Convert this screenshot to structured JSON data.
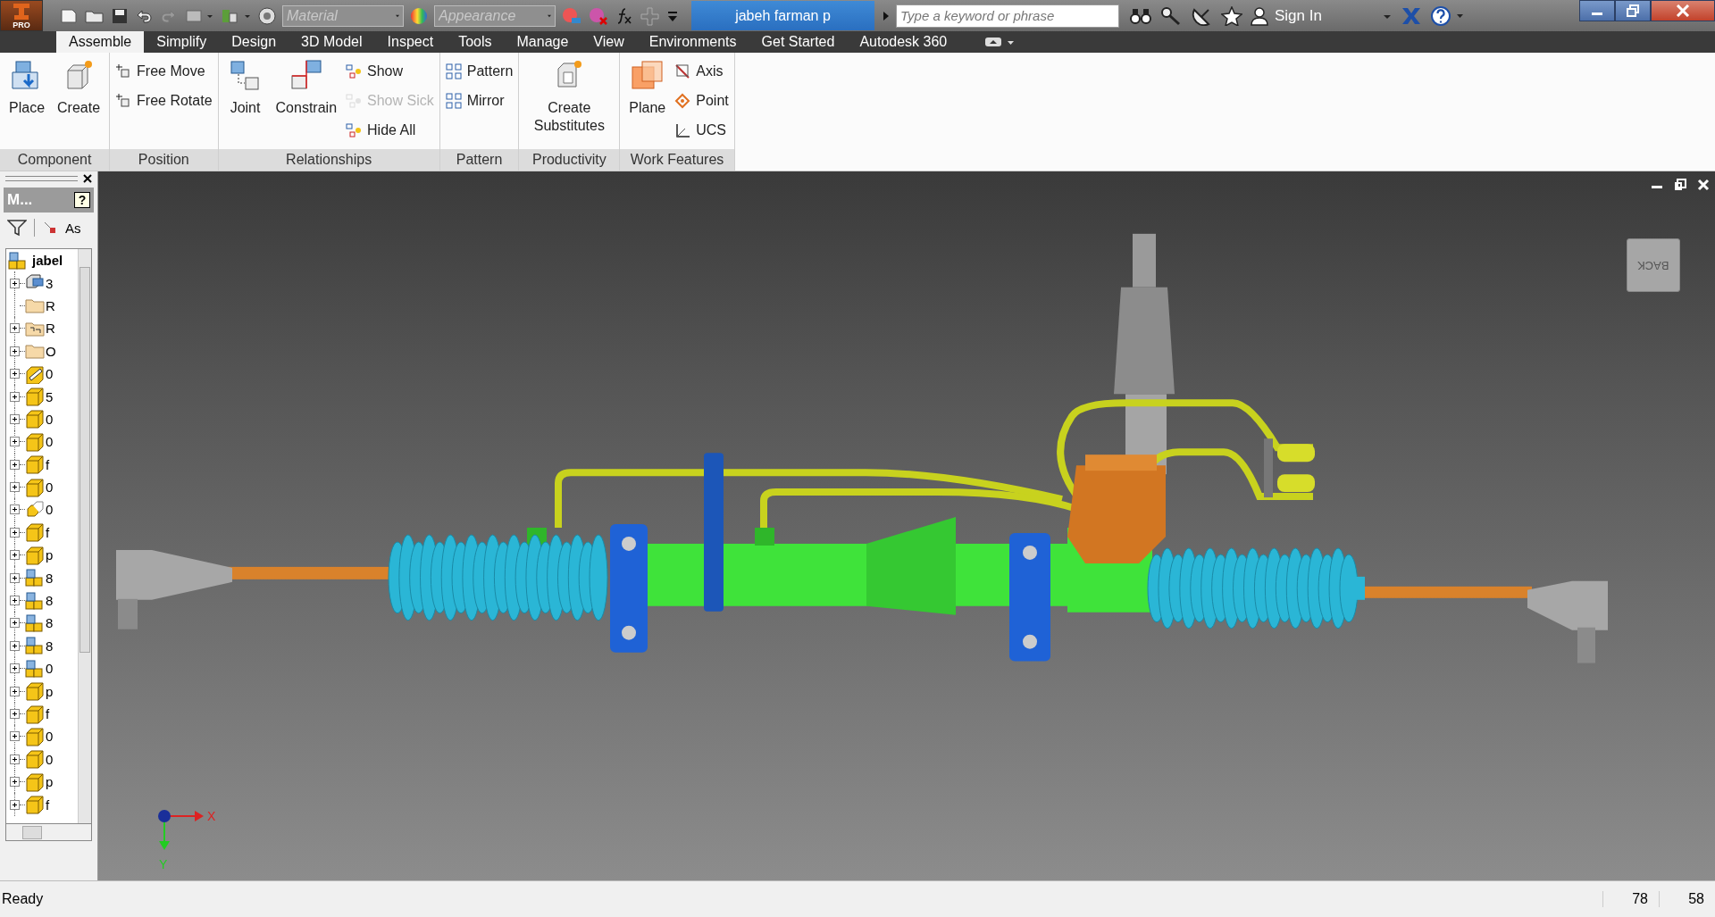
{
  "app_button": {
    "label": "PRO"
  },
  "quick_access": {
    "material": {
      "placeholder": "Material"
    },
    "appearance": {
      "placeholder": "Appearance"
    }
  },
  "document_title": "jabeh farman p",
  "search": {
    "placeholder": "Type a keyword or phrase"
  },
  "sign_in": "Sign In",
  "tabs": [
    {
      "label": "Assemble",
      "selected": true
    },
    {
      "label": "Simplify",
      "selected": false
    },
    {
      "label": "Design",
      "selected": false
    },
    {
      "label": "3D Model",
      "selected": false
    },
    {
      "label": "Inspect",
      "selected": false
    },
    {
      "label": "Tools",
      "selected": false
    },
    {
      "label": "Manage",
      "selected": false
    },
    {
      "label": "View",
      "selected": false
    },
    {
      "label": "Environments",
      "selected": false
    },
    {
      "label": "Get Started",
      "selected": false
    },
    {
      "label": "Autodesk 360",
      "selected": false
    }
  ],
  "ribbon": [
    {
      "title": "Component",
      "tools": [
        {
          "label": "Place",
          "kind": "large",
          "disabled": false
        },
        {
          "label": "Create",
          "kind": "large",
          "disabled": false
        }
      ]
    },
    {
      "title": "Position",
      "tools": [
        {
          "label": "Free Move",
          "kind": "small",
          "disabled": false
        },
        {
          "label": "Free Rotate",
          "kind": "small",
          "disabled": false
        }
      ]
    },
    {
      "title": "Relationships",
      "tools": [
        {
          "label": "Joint",
          "kind": "large",
          "disabled": false
        },
        {
          "label": "Constrain",
          "kind": "large",
          "disabled": false
        },
        {
          "label": "Show",
          "kind": "small",
          "disabled": false
        },
        {
          "label": "Show Sick",
          "kind": "small",
          "disabled": true
        },
        {
          "label": "Hide All",
          "kind": "small",
          "disabled": false
        }
      ]
    },
    {
      "title": "Pattern",
      "tools": [
        {
          "label": "Pattern",
          "kind": "small",
          "disabled": false
        },
        {
          "label": "Mirror",
          "kind": "small",
          "disabled": false
        }
      ]
    },
    {
      "title": "Productivity",
      "tools": [
        {
          "label": "Create Substitutes",
          "kind": "large",
          "disabled": false
        }
      ]
    },
    {
      "title": "Work Features",
      "tools": [
        {
          "label": "Plane",
          "kind": "large",
          "disabled": false
        },
        {
          "label": "Axis",
          "kind": "small",
          "disabled": false
        },
        {
          "label": "Point",
          "kind": "small",
          "disabled": false
        },
        {
          "label": "UCS",
          "kind": "small",
          "disabled": false
        }
      ]
    }
  ],
  "browser": {
    "title": "M...",
    "help": "?",
    "toolbar_label": "As",
    "tree": {
      "label": "jabel",
      "kind": "assembly",
      "expanded": true,
      "children": [
        {
          "label": "3",
          "kind": "view",
          "expandable": true
        },
        {
          "label": "R",
          "kind": "folder",
          "expandable": false
        },
        {
          "label": "R",
          "kind": "rep",
          "expandable": true
        },
        {
          "label": "O",
          "kind": "folder",
          "expandable": true
        },
        {
          "label": "0",
          "kind": "drawing",
          "expandable": true
        },
        {
          "label": "5",
          "kind": "part",
          "expandable": true
        },
        {
          "label": "0",
          "kind": "part",
          "expandable": true
        },
        {
          "label": "0",
          "kind": "part",
          "expandable": true
        },
        {
          "label": "f",
          "kind": "part",
          "expandable": true
        },
        {
          "label": "0",
          "kind": "part",
          "expandable": true
        },
        {
          "label": "0",
          "kind": "derived",
          "expandable": true
        },
        {
          "label": "f",
          "kind": "part",
          "expandable": true
        },
        {
          "label": "p",
          "kind": "part",
          "expandable": true
        },
        {
          "label": "8",
          "kind": "assembly",
          "expandable": true
        },
        {
          "label": "8",
          "kind": "assembly",
          "expandable": true
        },
        {
          "label": "8",
          "kind": "assembly",
          "expandable": true
        },
        {
          "label": "8",
          "kind": "assembly",
          "expandable": true
        },
        {
          "label": "0",
          "kind": "assembly",
          "expandable": true
        },
        {
          "label": "p",
          "kind": "part",
          "expandable": true
        },
        {
          "label": "f",
          "kind": "part",
          "expandable": true
        },
        {
          "label": "0",
          "kind": "part",
          "expandable": true
        },
        {
          "label": "0",
          "kind": "part",
          "expandable": true
        },
        {
          "label": "p",
          "kind": "part",
          "expandable": true
        },
        {
          "label": "f",
          "kind": "part",
          "expandable": true
        }
      ]
    }
  },
  "viewport": {
    "view_cube": "BACK",
    "axis_x": "X",
    "axis_y": "Y"
  },
  "status_bar": {
    "message": "Ready",
    "values": [
      "78",
      "58"
    ]
  }
}
